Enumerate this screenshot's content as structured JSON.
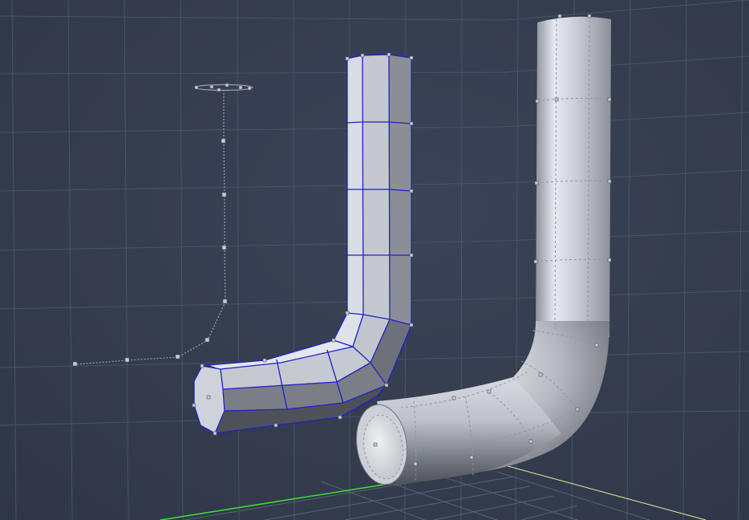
{
  "viewport": {
    "background_color": "#343c4e",
    "grid_color": "#4a5468",
    "axis_x_color": "#3cdc32",
    "axis_z_color": "#c8d08c",
    "wireframe_color": "#1d22c8"
  },
  "objects": [
    {
      "name": "profile-curve",
      "kind": "path curve with control points"
    },
    {
      "name": "low-poly-pipe",
      "kind": "polygon mesh cage, selected"
    },
    {
      "name": "smooth-pipe",
      "kind": "subdivided surface"
    }
  ]
}
